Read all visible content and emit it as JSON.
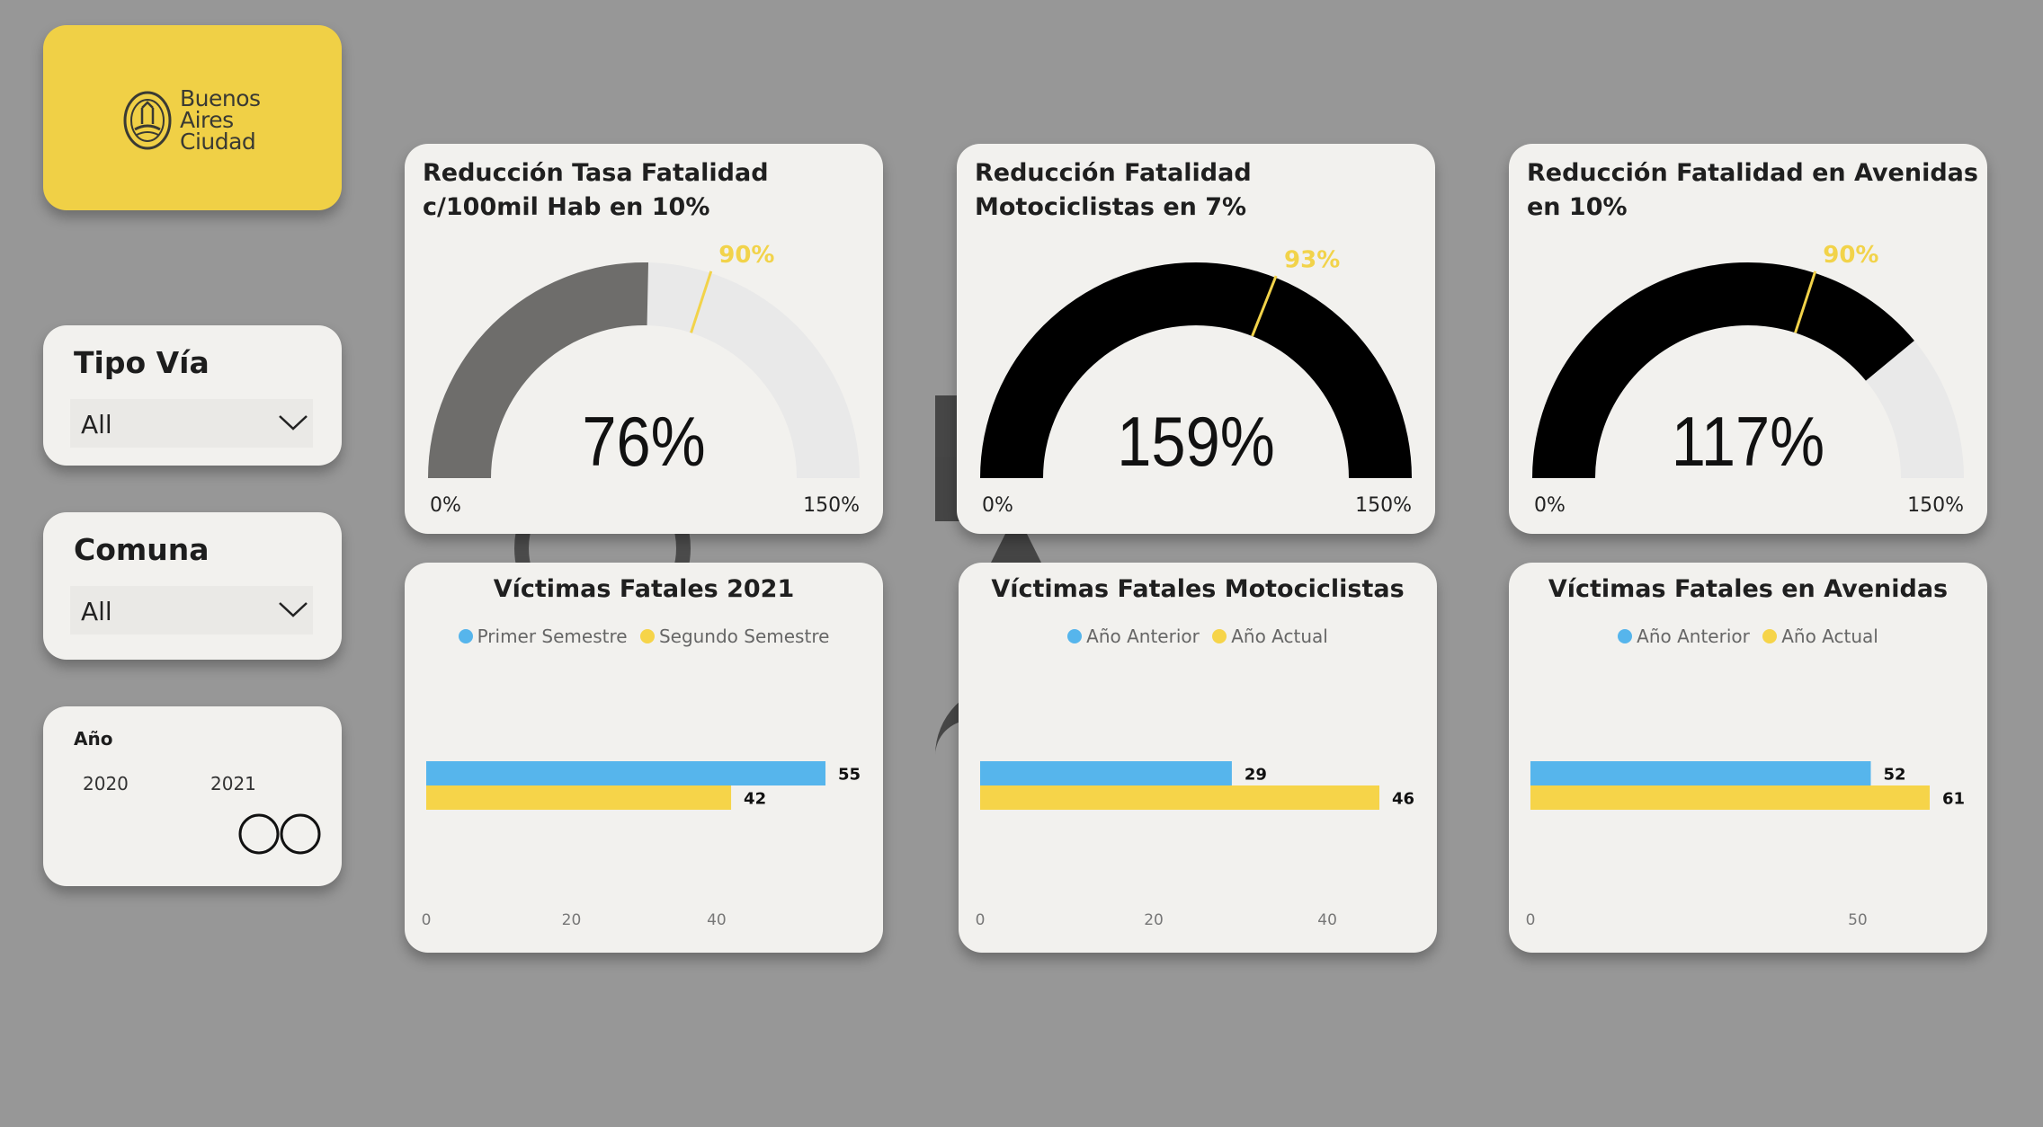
{
  "colors": {
    "background": "#979797",
    "card": "#f2f1ee",
    "brand_yellow": "#f0d046",
    "target": "#f2d34a",
    "gauge_fill_1": "#6e6d6b",
    "gauge_fill_dark": "#000000",
    "gauge_track": "#e9e9e9",
    "series_blue": "#56b5ec",
    "series_yellow": "#f6d449"
  },
  "logo": {
    "line1": "Buenos",
    "line2": "Aires",
    "line3": "Ciudad",
    "icon": "city-seal-icon"
  },
  "filters": {
    "tipo_via": {
      "label": "Tipo Vía",
      "value": "All"
    },
    "comuna": {
      "label": "Comuna",
      "value": "All"
    },
    "anio": {
      "label": "Año",
      "start": "2020",
      "end": "2021"
    }
  },
  "chart_data": [
    {
      "type": "gauge",
      "title": "Reducción Tasa Fatalidad c/100mil Hab en 10%",
      "value": 76,
      "value_label": "76%",
      "target": 90,
      "target_label": "90%",
      "min": 0,
      "min_label": "0%",
      "max": 150,
      "max_label": "150%",
      "fill_color": "#6e6d6b"
    },
    {
      "type": "gauge",
      "title": "Reducción Fatalidad Motociclistas en 7%",
      "value": 159,
      "value_label": "159%",
      "target": 93,
      "target_label": "93%",
      "min": 0,
      "min_label": "0%",
      "max": 150,
      "max_label": "150%",
      "fill_color": "#000000"
    },
    {
      "type": "gauge",
      "title": "Reducción Fatalidad en Avenidas en 10%",
      "value": 117,
      "value_label": "117%",
      "target": 90,
      "target_label": "90%",
      "min": 0,
      "min_label": "0%",
      "max": 150,
      "max_label": "150%",
      "fill_color": "#000000"
    },
    {
      "type": "bar",
      "orientation": "horizontal",
      "title": "Víctimas Fatales 2021",
      "series": [
        {
          "name": "Primer Semestre",
          "values": [
            55
          ],
          "color": "#56b5ec"
        },
        {
          "name": "Segundo Semestre",
          "values": [
            42
          ],
          "color": "#f6d449"
        }
      ],
      "xlim": [
        0,
        55
      ],
      "xticks": [
        0,
        20,
        40
      ]
    },
    {
      "type": "bar",
      "orientation": "horizontal",
      "title": "Víctimas Fatales Motociclistas",
      "series": [
        {
          "name": "Año Anterior",
          "values": [
            29
          ],
          "color": "#56b5ec"
        },
        {
          "name": "Año Actual",
          "values": [
            46
          ],
          "color": "#f6d449"
        }
      ],
      "xlim": [
        0,
        46
      ],
      "xticks": [
        0,
        20,
        40
      ]
    },
    {
      "type": "bar",
      "orientation": "horizontal",
      "title": "Víctimas Fatales en Avenidas",
      "series": [
        {
          "name": "Año Anterior",
          "values": [
            52
          ],
          "color": "#56b5ec"
        },
        {
          "name": "Año Actual",
          "values": [
            61
          ],
          "color": "#f6d449"
        }
      ],
      "xlim": [
        0,
        61
      ],
      "xticks": [
        0,
        50
      ]
    }
  ]
}
